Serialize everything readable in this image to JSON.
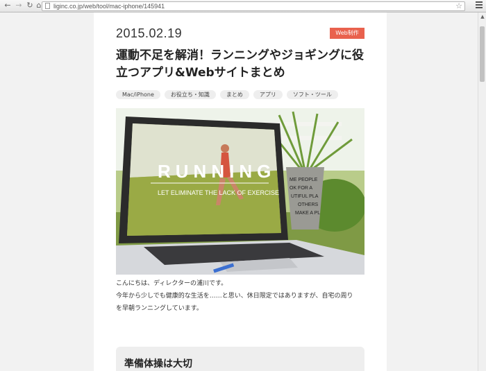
{
  "browser": {
    "url": "liginc.co.jp/web/tool/mac-iphone/145941"
  },
  "article": {
    "date": "2015.02.19",
    "category": "Web制作",
    "title": "運動不足を解消！ランニングやジョギングに役立つアプリ&Webサイトまとめ",
    "tags": [
      "Mac/iPhone",
      "お役立ち・知識",
      "まとめ",
      "アプリ",
      "ソフト・ツール"
    ],
    "hero": {
      "word": "RUNNING",
      "tagline": "LET ELIMINATE THE LACK OF EXERCISE",
      "pot_text": "ME PEOPLE\nOK FOR A\nUTIFUL PLACE\nOTHERS\nMAKE A PL\nutiful"
    },
    "body": [
      "こんにちは、ディレクターの浦川です。",
      "今年から少しでも健康的な生活を……と思い、休日限定ではありますが、自宅の周り",
      "を早朝ランニングしています。"
    ],
    "section_heading": "準備体操は大切"
  }
}
